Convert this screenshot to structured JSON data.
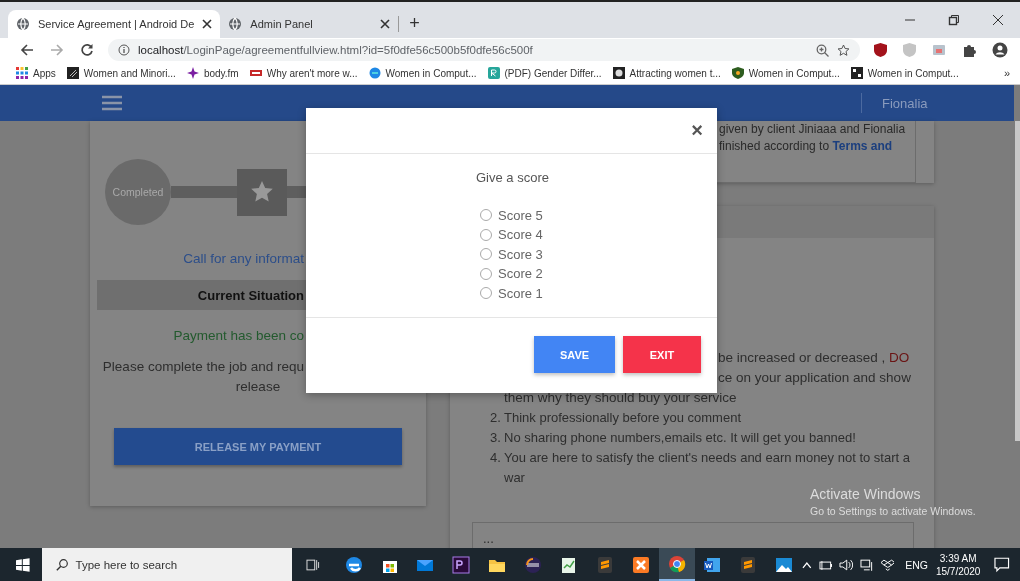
{
  "browser": {
    "tabs": [
      {
        "title": "Service Agreement | Android De",
        "selected": true
      },
      {
        "title": "Admin Panel",
        "selected": false
      }
    ],
    "new_tab": "+",
    "address": {
      "host": "localhost",
      "path": "/LoginPage/agreementfullview.html?id=5f0dfe56c500b5f0dfe56c500f"
    },
    "bookmarks": [
      {
        "label": "Apps"
      },
      {
        "label": "Women and Minori..."
      },
      {
        "label": "body.fm"
      },
      {
        "label": "Why aren't more w..."
      },
      {
        "label": "Women in Comput..."
      },
      {
        "label": "(PDF) Gender Differ..."
      },
      {
        "label": "Attracting women t..."
      },
      {
        "label": "Women in Comput..."
      },
      {
        "label": "Women in Comput..."
      }
    ],
    "bookmarks_more": "»"
  },
  "navbar": {
    "user": "Fionalia"
  },
  "left_card": {
    "step": "Completed",
    "contact": "Call for any informat",
    "situation_title": "Current Situation",
    "status": "Payment has been co",
    "instruction": "Please complete the job and requ",
    "instruction_end": "release",
    "release_button": "RELEASE MY PAYMENT"
  },
  "agreement_card": {
    "line_1": "given by client Jiniaaa and Fionalia",
    "line_2": {
      "text": "finished according to ",
      "link": "Terms and"
    }
  },
  "rules_card": {
    "line_1": {
      "text": "be increased or decreased , ",
      "warning": "DO"
    },
    "line_2": "ce on your application and show",
    "line_3": "them why they should buy your service",
    "rules": [
      {
        "number": "2.",
        "text": "Think professionally before you comment"
      },
      {
        "number": "3.",
        "text": "No sharing phone numbers,emails etc. It will get you banned!"
      },
      {
        "number": "4.",
        "text": "You are here to satisfy the client's needs and earn money not to start a war"
      }
    ],
    "comment_placeholder": "..."
  },
  "modal": {
    "close": "×",
    "prompt": "Give a score",
    "options": [
      {
        "label": "Score 5",
        "selected": false
      },
      {
        "label": "Score 4",
        "selected": false
      },
      {
        "label": "Score 3",
        "selected": false
      },
      {
        "label": "Score 2",
        "selected": false
      },
      {
        "label": "Score 1",
        "selected": false
      }
    ],
    "save": "SAVE",
    "exit": "EXIT"
  },
  "activation": {
    "title": "Activate Windows",
    "hint": "Go to Settings to activate Windows."
  },
  "taskbar": {
    "search_placeholder": "Type here to search",
    "apps": [
      {
        "selected": false
      },
      {
        "selected": false
      },
      {
        "selected": false
      },
      {
        "selected": false
      },
      {
        "selected": false
      },
      {
        "selected": false
      },
      {
        "selected": false
      },
      {
        "selected": false
      },
      {
        "selected": false
      },
      {
        "selected": true
      },
      {
        "selected": false
      },
      {
        "selected": false
      },
      {
        "selected": false
      }
    ],
    "language": "ENG",
    "time": "3:39 AM",
    "date": "15/7/2020"
  }
}
